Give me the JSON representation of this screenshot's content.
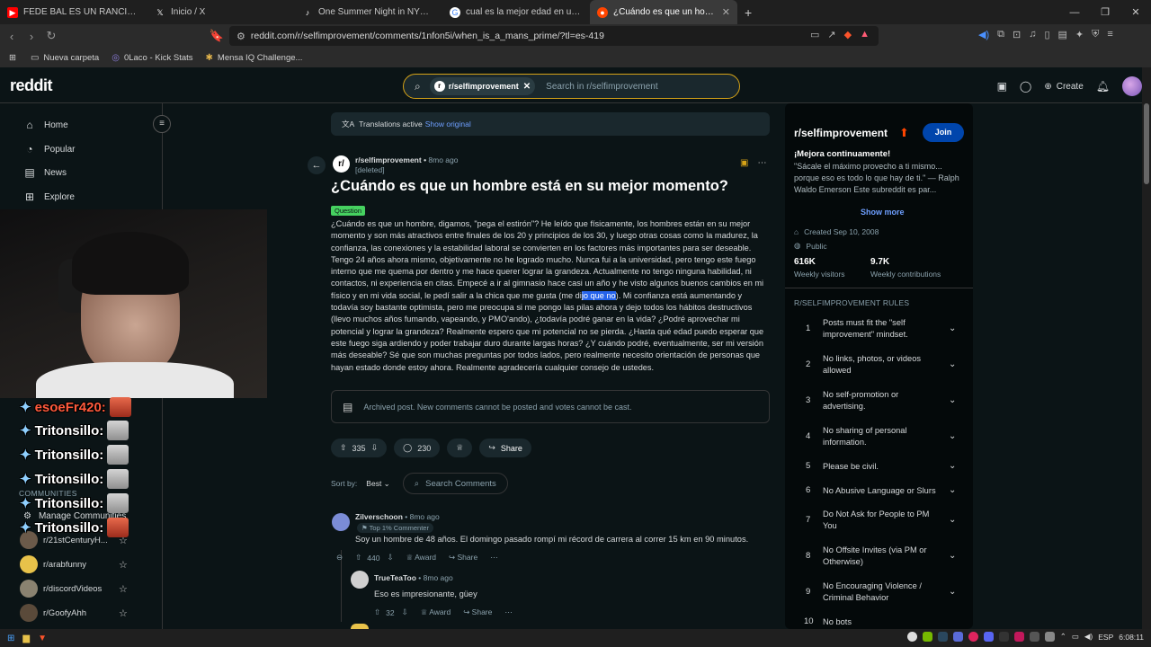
{
  "browser": {
    "tabs": [
      {
        "title": "FEDE BAL ES UN RANCIOVICH? Me D",
        "icon": "youtube-icon",
        "color": "#ff0000"
      },
      {
        "title": "Inicio / X",
        "icon": "x-icon",
        "color": "#000000"
      },
      {
        "title": "One Summer Night in NYC | TikTok",
        "icon": "tiktok-icon",
        "color": "#111111"
      },
      {
        "title": "cual es la mejor edad en un hombre",
        "icon": "google-icon",
        "color": "#4285f4"
      },
      {
        "title": "¿Cuándo es que un hombre está",
        "icon": "reddit-icon",
        "color": "#ff4500"
      }
    ],
    "url": "reddit.com/r/selfimprovement/comments/1nfon5i/when_is_a_mans_prime/?tl=es-419",
    "bookmarks": [
      "Nueva carpeta",
      "0Laco - Kick Stats",
      "Mensa IQ Challenge..."
    ]
  },
  "header": {
    "logo": "reddit",
    "search_chip": "r/selfimprovement",
    "search_placeholder": "Search in r/selfimprovement",
    "create": "Create"
  },
  "leftnav": {
    "items": [
      "Home",
      "Popular",
      "News",
      "Explore"
    ],
    "communities_label": "COMMUNITIES",
    "manage": "Manage Communities",
    "communities": [
      "r/21stCenturyH...",
      "r/arabfunny",
      "r/discordVideos",
      "r/GoofyAhh"
    ]
  },
  "overlay": {
    "chat": [
      {
        "user": "esoeFr420:",
        "red": true
      },
      {
        "user": "Tritonsillo:",
        "red": false
      },
      {
        "user": "Tritonsillo:",
        "red": false
      },
      {
        "user": "Tritonsillo:",
        "red": false
      },
      {
        "user": "Tritonsillo:",
        "red": false
      },
      {
        "user": "Tritonsillo:",
        "red": false
      }
    ]
  },
  "post": {
    "translation": "Translations active",
    "show_original": "Show original",
    "subreddit": "r/selfimprovement",
    "time": "8mo ago",
    "author": "[deleted]",
    "title": "¿Cuándo es que un hombre está en su mejor momento?",
    "flair": "Question",
    "body_before": "¿Cuándo es que un hombre, digamos, \"pega el estirón\"? He leído que físicamente, los hombres están en su mejor momento y son más atractivos entre finales de los 20 y principios de los 30, y luego otras cosas como la madurez, la confianza, las conexiones y la estabilidad laboral se convierten en los factores más importantes para ser deseable. Tengo 24 años ahora mismo, objetivamente no he logrado mucho. Nunca fui a la universidad, pero tengo este fuego interno que me quema por dentro y me hace querer lograr la grandeza. Actualmente no tengo ninguna habilidad, ni contactos, ni experiencia en citas. Empecé a ir al gimnasio hace casi un año y he visto algunos buenos cambios en mi físico y en mi vida social, le pedí salir a la chica que me gusta (me di",
    "body_highlight": "jo que no",
    "body_after": "). Mi confianza está aumentando y todavía soy bastante optimista, pero me preocupa si me pongo las pilas ahora y dejo todos los hábitos destructivos (llevo muchos años fumando, vapeando, y PMO'ando), ¿todavía podré ganar en la vida? ¿Podré aprovechar mi potencial y lograr la grandeza? Realmente espero que mi potencial no se pierda. ¿Hasta qué edad puedo esperar que este fuego siga ardiendo y poder trabajar duro durante largas horas? ¿Y cuándo podré, eventualmente, ser mi versión más deseable? Sé que son muchas preguntas por todos lados, pero realmente necesito orientación de personas que hayan estado donde estoy ahora. Realmente agradecería cualquier consejo de ustedes.",
    "archived": "Archived post. New comments cannot be posted and votes cannot be cast.",
    "votes": "335",
    "comments": "230",
    "share": "Share",
    "sort_label": "Sort by:",
    "sort_value": "Best",
    "search_comments": "Search Comments"
  },
  "comments": [
    {
      "user": "Zilverschoon",
      "time": "8mo ago",
      "badge": "Top 1% Commenter",
      "text": "Soy un hombre de 48 años. El domingo pasado rompí mi récord de carrera al correr 15 km en 90 minutos.",
      "votes": "440",
      "award": "Award",
      "share": "Share"
    },
    {
      "user": "TrueTeaToo",
      "time": "8mo ago",
      "text": "Eso es impresionante, güey",
      "votes": "32",
      "award": "Award",
      "share": "Share"
    }
  ],
  "sidebar": {
    "name": "r/selfimprovement",
    "join": "Join",
    "tagline": "¡Mejora continuamente!",
    "description": "\"Sácale el máximo provecho a ti mismo... porque eso es todo lo que hay de ti.\" — Ralph Waldo Emerson Este subreddit es par...",
    "show_more": "Show more",
    "created": "Created Sep 10, 2008",
    "visibility": "Public",
    "visitors": "616K",
    "visitors_label": "Weekly visitors",
    "contributions": "9.7K",
    "contributions_label": "Weekly contributions",
    "rules_title": "R/SELFIMPROVEMENT RULES",
    "rules": [
      "Posts must fit the \"self improvement\" mindset.",
      "No links, photos, or videos allowed",
      "No self-promotion or advertising.",
      "No sharing of personal information.",
      "Please be civil.",
      "No Abusive Language or Slurs",
      "Do Not Ask for People to PM You",
      "No Offsite Invites (via PM or Otherwise)",
      "No Encouraging Violence / Criminal Behavior",
      "No bots"
    ]
  },
  "taskbar": {
    "lang": "ESP",
    "time": "6:08:11"
  }
}
